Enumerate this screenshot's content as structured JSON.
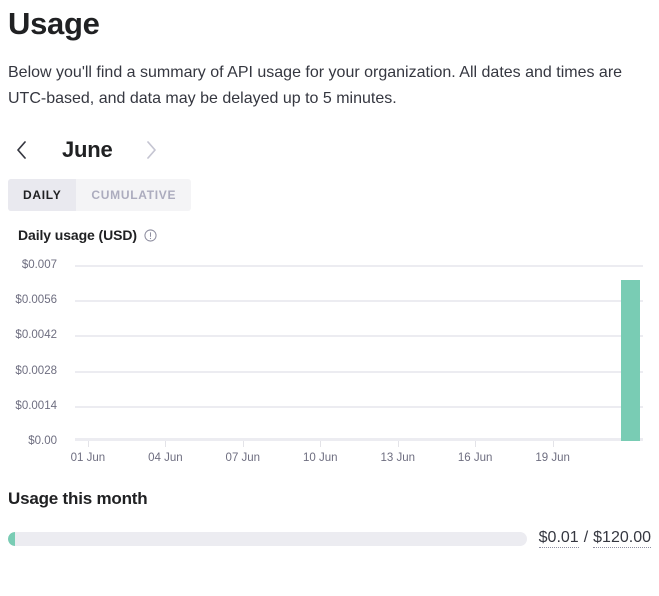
{
  "page": {
    "title": "Usage",
    "intro": "Below you'll find a summary of API usage for your organization. All dates and times are UTC-based, and data may be delayed up to 5 minutes."
  },
  "month_nav": {
    "prev_icon": "chevron-left-icon",
    "next_icon": "chevron-right-icon",
    "label": "June"
  },
  "tabs": [
    {
      "label": "DAILY",
      "active": true
    },
    {
      "label": "CUMULATIVE",
      "active": false
    }
  ],
  "chart_header": {
    "title": "Daily usage (USD)",
    "info_icon": "info-icon"
  },
  "usage_section": {
    "title": "Usage this month",
    "used": "$0.01",
    "separator": "/",
    "limit": "$120.00",
    "fill_color": "#79ccb4",
    "track_color": "#ececf1"
  },
  "chart_data": {
    "type": "bar",
    "title": "Daily usage (USD)",
    "xlabel": "",
    "ylabel": "",
    "ylim": [
      0,
      0.007
    ],
    "grid": true,
    "legend": null,
    "bar_color": "#79ccb4",
    "ytick_labels": [
      "$0.007",
      "$0.0056",
      "$0.0042",
      "$0.0028",
      "$0.0014",
      "$0.00"
    ],
    "ytick_values": [
      0.007,
      0.0056,
      0.0042,
      0.0028,
      0.0014,
      0
    ],
    "xtick_labels": [
      "01 Jun",
      "04 Jun",
      "07 Jun",
      "10 Jun",
      "13 Jun",
      "16 Jun",
      "19 Jun"
    ],
    "xtick_days": [
      1,
      4,
      7,
      10,
      13,
      16,
      19
    ],
    "categories": [
      "01 Jun",
      "02 Jun",
      "03 Jun",
      "04 Jun",
      "05 Jun",
      "06 Jun",
      "07 Jun",
      "08 Jun",
      "09 Jun",
      "10 Jun",
      "11 Jun",
      "12 Jun",
      "13 Jun",
      "14 Jun",
      "15 Jun",
      "16 Jun",
      "17 Jun",
      "18 Jun",
      "19 Jun",
      "20 Jun",
      "21 Jun",
      "22 Jun"
    ],
    "values": [
      0,
      0,
      0,
      0,
      0,
      0,
      0,
      0,
      0,
      0,
      0,
      0,
      0,
      0,
      0,
      0,
      0,
      0,
      0,
      0,
      0,
      0.0064
    ]
  }
}
